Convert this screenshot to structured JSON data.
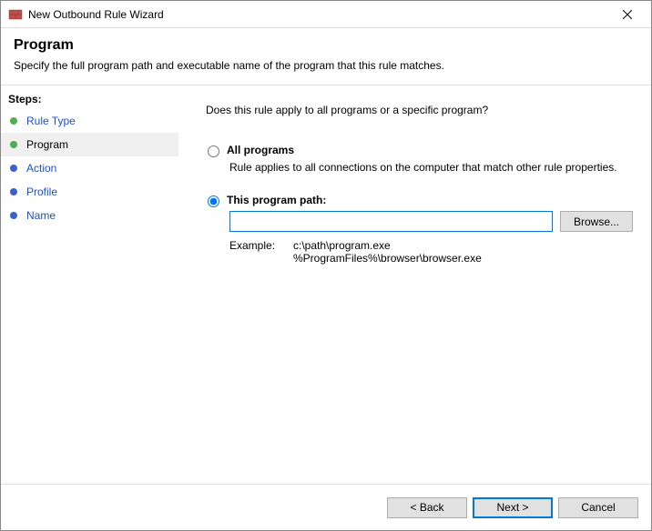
{
  "window": {
    "title": "New Outbound Rule Wizard"
  },
  "header": {
    "title": "Program",
    "subtitle": "Specify the full program path and executable name of the program that this rule matches."
  },
  "sidebar": {
    "steps_label": "Steps:",
    "items": [
      {
        "label": "Rule Type",
        "state": "completed"
      },
      {
        "label": "Program",
        "state": "current"
      },
      {
        "label": "Action",
        "state": "future"
      },
      {
        "label": "Profile",
        "state": "future"
      },
      {
        "label": "Name",
        "state": "future"
      }
    ]
  },
  "content": {
    "question": "Does this rule apply to all programs or a specific program?",
    "option_all": {
      "label": "All programs",
      "desc": "Rule applies to all connections on the computer that match other rule properties."
    },
    "option_path": {
      "label": "This program path:",
      "value": "",
      "browse": "Browse...",
      "example_label": "Example:",
      "example_text": "c:\\path\\program.exe\n%ProgramFiles%\\browser\\browser.exe"
    },
    "selected": "path"
  },
  "footer": {
    "back": "< Back",
    "next": "Next >",
    "cancel": "Cancel"
  }
}
